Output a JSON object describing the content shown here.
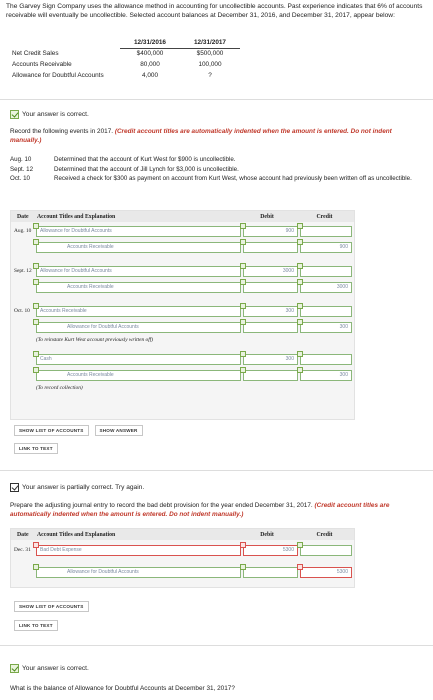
{
  "intro": "The Garvey Sign Company uses the allowance method in accounting for uncollectible accounts. Past experience indicates that 6% of accounts receivable will eventually be uncollectible. Selected account balances at December 31, 2016, and December 31, 2017, appear below:",
  "balances": {
    "headers": [
      "",
      "12/31/2016",
      "12/31/2017"
    ],
    "rows": [
      [
        "Net Credit Sales",
        "$400,000",
        "$500,000"
      ],
      [
        "Accounts Receivable",
        "80,000",
        "100,000"
      ],
      [
        "Allowance for Doubtful Accounts",
        "4,000",
        "?"
      ]
    ]
  },
  "status1": "Your answer is correct.",
  "instr1": "Record the following events in 2017.",
  "instr1_red": "(Credit account titles are automatically indented when the amount is entered. Do not indent manually.)",
  "events": [
    {
      "date": "Aug. 10",
      "text": "Determined that the account of Kurt West for $900 is uncollectible."
    },
    {
      "date": "Sept. 12",
      "text": "Determined that the account of Jill Lynch for $3,000 is uncollectible."
    },
    {
      "date": "Oct. 10",
      "text": "Received a check for $300 as payment on account from Kurt West, whose account had previously been written off as uncollectible."
    }
  ],
  "jheaders": {
    "date": "Date",
    "title": "Account Titles and Explanation",
    "debit": "Debit",
    "credit": "Credit"
  },
  "j1": {
    "rows": [
      {
        "date": "Aug. 10",
        "account": "Allowance for Doubtful Accounts",
        "debit": "900",
        "credit": ""
      },
      {
        "date": "",
        "account": "Accounts Receivable",
        "debit": "",
        "credit": "900"
      },
      {
        "date": "Sept. 12",
        "account": "Allowance for Doubtful Accounts",
        "debit": "3000",
        "credit": ""
      },
      {
        "date": "",
        "account": "Accounts Receivable",
        "debit": "",
        "credit": "3000"
      },
      {
        "date": "Oct. 10",
        "account": "Accounts Receivable",
        "debit": "300",
        "credit": ""
      },
      {
        "date": "",
        "account": "Allowance for Doubtful Accounts",
        "debit": "",
        "credit": "300"
      },
      {
        "date": "",
        "account": "Cash",
        "debit": "300",
        "credit": ""
      },
      {
        "date": "",
        "account": "Accounts Receivable",
        "debit": "",
        "credit": "300"
      }
    ],
    "note1": "(To reinstate Kurt West account previously written off)",
    "note2": "(To record collection)"
  },
  "buttons": {
    "show_list": "SHOW LIST OF ACCOUNTS",
    "show_answer": "SHOW ANSWER",
    "link_text": "LINK TO TEXT"
  },
  "status2": "Your answer is partially correct.  Try again.",
  "instr2": "Prepare the adjusting journal entry to record the bad debt provision for the year ended December 31, 2017.",
  "instr2_red": "(Credit account titles are automatically indented when the amount is entered. Do not indent manually.)",
  "j2": {
    "rows": [
      {
        "date": "Dec. 31",
        "account": "Bad Debt Expense",
        "debit": "5300",
        "credit": ""
      },
      {
        "date": "",
        "account": "Allowance for Doubtful Accounts",
        "debit": "",
        "credit": "5300"
      }
    ]
  },
  "status3": "Your answer is correct.",
  "question": "What is the balance of Allowance for Doubtful Accounts at December 31, 2017?"
}
